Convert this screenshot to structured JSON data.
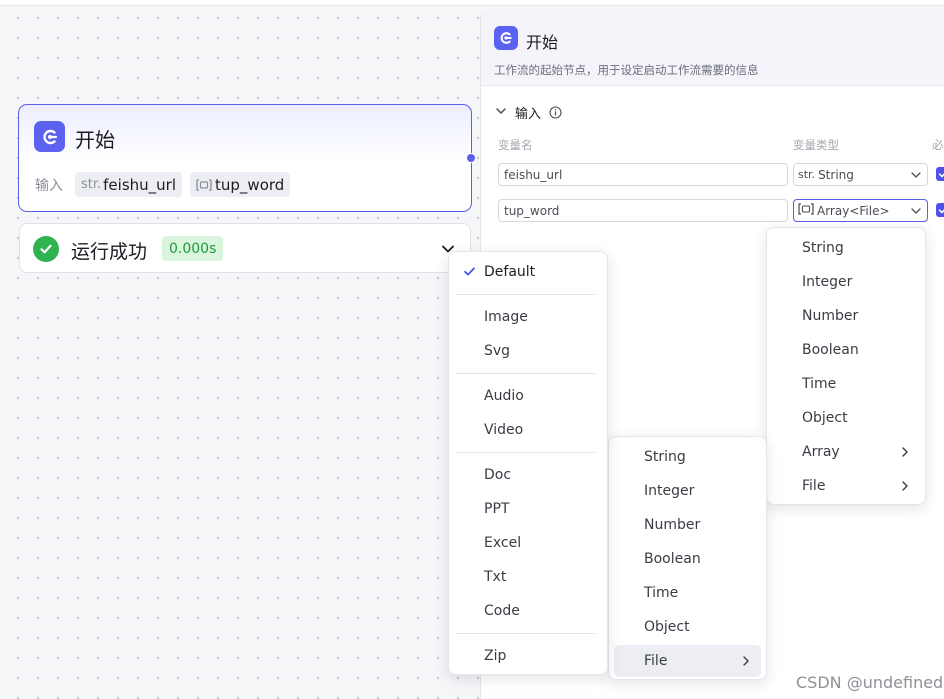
{
  "start_node": {
    "title": "开始",
    "inputs_label": "输入",
    "inputs": [
      {
        "prefix": "str.",
        "name": "feishu_url"
      },
      {
        "prefix": "",
        "name": "tup_word"
      }
    ]
  },
  "run_status": {
    "label": "运行成功",
    "time": "0.000s"
  },
  "panel": {
    "title": "开始",
    "description": "工作流的起始节点，用于设定启动工作流需要的信息",
    "section_label": "输入",
    "columns": {
      "name": "变量名",
      "type": "变量类型",
      "required": "必"
    },
    "rows": [
      {
        "name": "feishu_url",
        "type_prefix": "str.",
        "type": "String"
      },
      {
        "name": "tup_word",
        "type_prefix": "",
        "type": "Array<File>"
      }
    ]
  },
  "file_type_menu": {
    "items": [
      "Default",
      "Image",
      "Svg",
      "Audio",
      "Video",
      "Doc",
      "PPT",
      "Excel",
      "Txt",
      "Code",
      "Zip"
    ],
    "selected": "Default"
  },
  "type_menu_top": {
    "items": [
      "String",
      "Integer",
      "Number",
      "Boolean",
      "Time",
      "Object",
      "Array",
      "File"
    ]
  },
  "type_menu_sub": {
    "items": [
      "String",
      "Integer",
      "Number",
      "Boolean",
      "Time",
      "Object",
      "File"
    ],
    "hovered": "File"
  },
  "watermark": "CSDN @undefined",
  "colors": {
    "accent": "#5c5ee8",
    "success": "#2fb350",
    "icon_bg": "#5b62f0"
  }
}
